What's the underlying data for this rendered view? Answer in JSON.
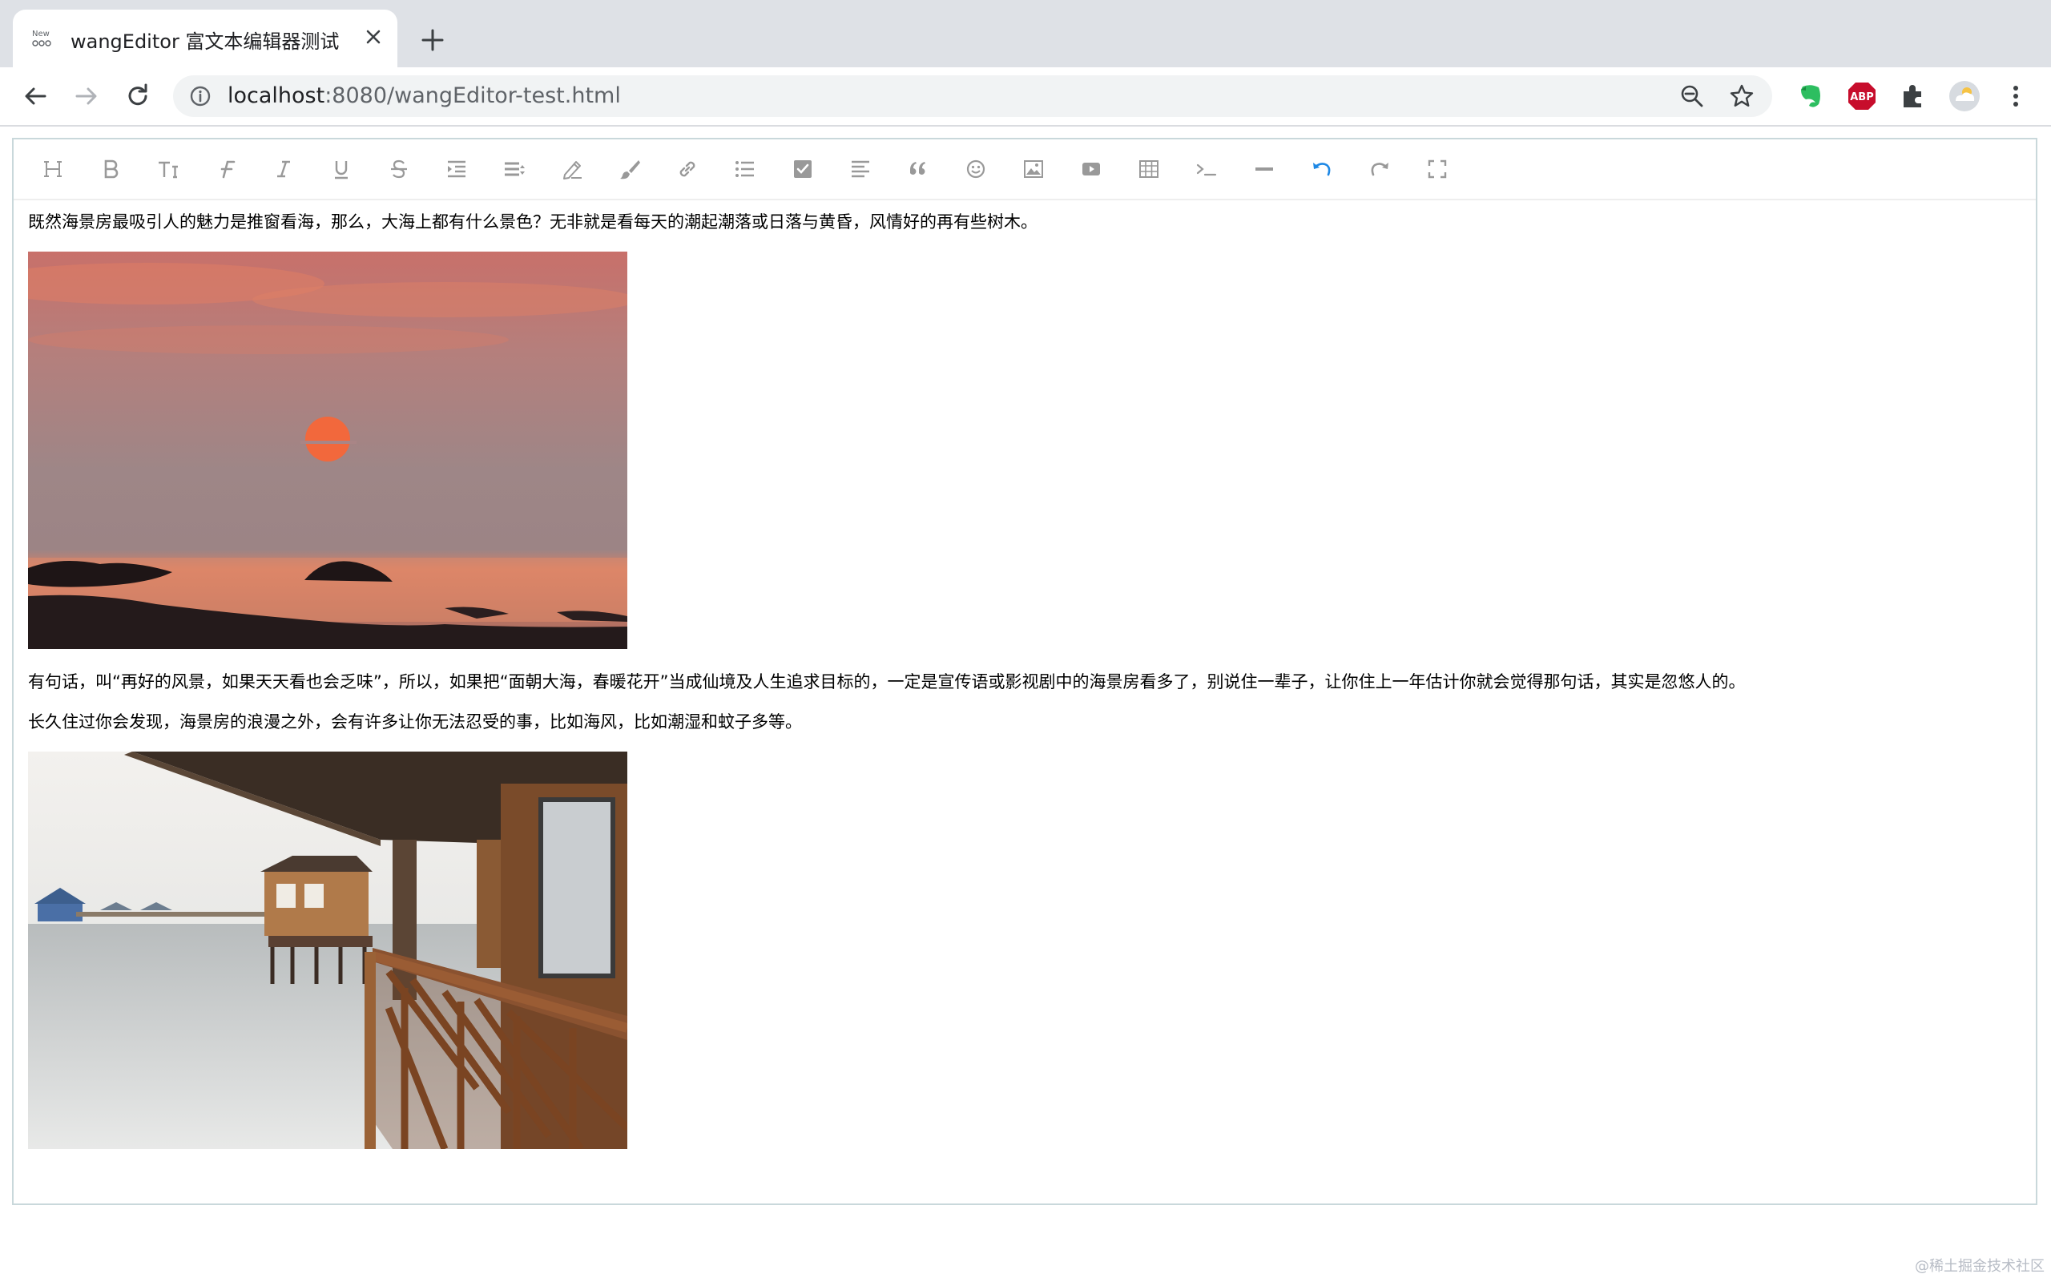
{
  "browser": {
    "tab": {
      "favicon_text": "New\nSee",
      "title": "wangEditor 富文本编辑器测试"
    },
    "address": {
      "host": "localhost",
      "rest": ":8080/wangEditor-test.html"
    },
    "extensions": [
      "evernote-icon",
      "adblock-plus-icon",
      "extensions-puzzle-icon",
      "profile-avatar",
      "menu-icon"
    ],
    "abp_label": "ABP"
  },
  "editor": {
    "toolbar": [
      {
        "name": "heading",
        "icon": "H"
      },
      {
        "name": "bold",
        "icon": "B"
      },
      {
        "name": "font-size",
        "icon": "TI"
      },
      {
        "name": "font-family",
        "icon": "F"
      },
      {
        "name": "italic",
        "icon": "I"
      },
      {
        "name": "underline",
        "icon": "U"
      },
      {
        "name": "strikethrough",
        "icon": "S"
      },
      {
        "name": "indent",
        "icon": "indent"
      },
      {
        "name": "line-height",
        "icon": "line-height"
      },
      {
        "name": "font-color",
        "icon": "pen"
      },
      {
        "name": "background-color",
        "icon": "brush"
      },
      {
        "name": "link",
        "icon": "link"
      },
      {
        "name": "list",
        "icon": "list"
      },
      {
        "name": "todo",
        "icon": "checkbox"
      },
      {
        "name": "justify",
        "icon": "align"
      },
      {
        "name": "quote",
        "icon": "quote"
      },
      {
        "name": "emoticon",
        "icon": "smile"
      },
      {
        "name": "image",
        "icon": "image"
      },
      {
        "name": "video",
        "icon": "video"
      },
      {
        "name": "table",
        "icon": "table"
      },
      {
        "name": "code",
        "icon": "code"
      },
      {
        "name": "split-line",
        "icon": "hr"
      },
      {
        "name": "undo",
        "icon": "undo"
      },
      {
        "name": "redo",
        "icon": "redo"
      },
      {
        "name": "fullscreen",
        "icon": "fullscreen"
      }
    ],
    "paragraphs": {
      "p1": "既然海景房最吸引人的魅力是推窗看海，那么，大海上都有什么景色？无非就是看每天的潮起潮落或日落与黄昏，风情好的再有些树木。",
      "p2": "有句话，叫“再好的风景，如果天天看也会乏味”，所以，如果把“面朝大海，春暖花开”当成仙境及人生追求目标的，一定是宣传语或影视剧中的海景房看多了，别说住一辈子，让你住上一年估计你就会觉得那句话，其实是忽悠人的。",
      "p3": "长久住过你会发现，海景房的浪漫之外，会有许多让你无法忍受的事，比如海风，比如潮湿和蚊子多等。"
    },
    "undo_color": "#1e88e5",
    "icon_color": "#999999"
  },
  "watermark": "@稀土掘金技术社区"
}
